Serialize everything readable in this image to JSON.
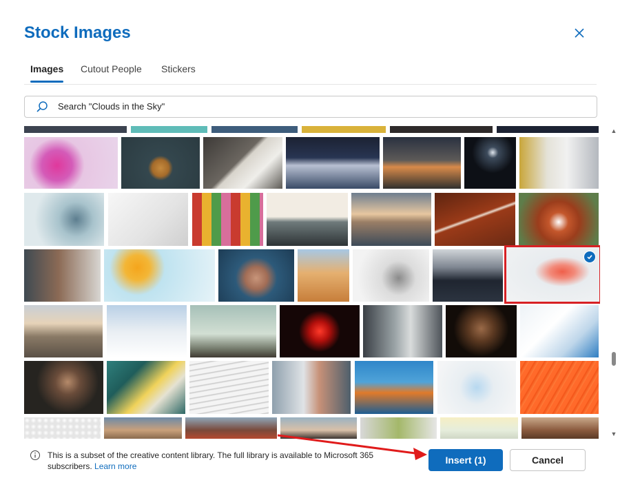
{
  "dialog": {
    "title": "Stock Images",
    "close_icon": "close-icon"
  },
  "tabs": [
    {
      "label": "Images",
      "active": true
    },
    {
      "label": "Cutout People",
      "active": false
    },
    {
      "label": "Stickers",
      "active": false
    }
  ],
  "search": {
    "icon": "search-icon",
    "placeholder": "Search \"Clouds in the Sky\""
  },
  "gallery": {
    "selected_count": 1,
    "selected_image": "paint-stroke-on-white"
  },
  "footer": {
    "info_text": "This is a subset of the creative content library. The full library is available to Microsoft 365 subscribers.",
    "learn_more": "Learn more",
    "insert_label": "Insert (1)",
    "cancel_label": "Cancel"
  },
  "colors": {
    "accent": "#0f6cbd",
    "selection_outline": "#d72024",
    "annotation_arrow": "#e01b1b"
  }
}
